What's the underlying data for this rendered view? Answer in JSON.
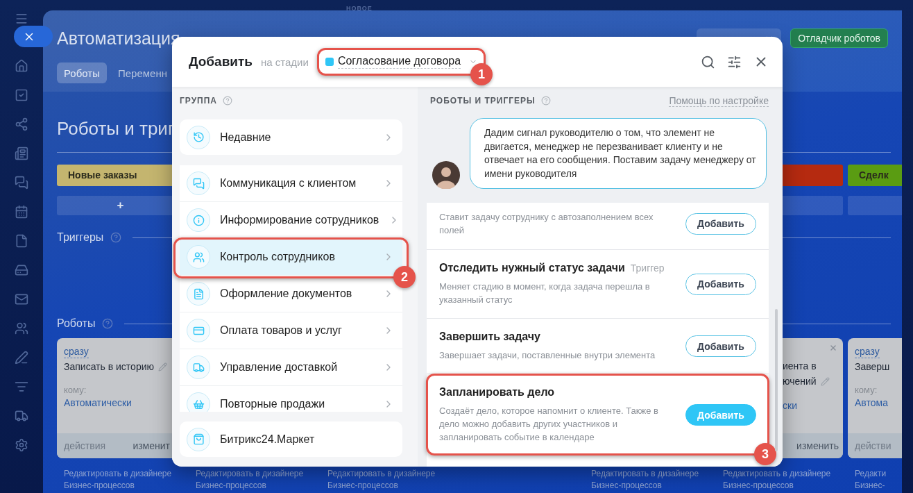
{
  "top_label": "НОВОЕ",
  "page": {
    "title": "Автоматизация",
    "debugger_button": "Отладчик роботов",
    "tabs": [
      {
        "label": "Роботы",
        "selected": true
      },
      {
        "label": "Переменн",
        "selected": false
      }
    ],
    "heading": "Роботы и триг",
    "triggers_label": "Триггеры",
    "robots_label": "Роботы",
    "columns": [
      {
        "stage": {
          "label": "Новые заказы",
          "color": "#c4b56f"
        },
        "add_bar": true,
        "add_label": "+",
        "card": {
          "delay": "сразу",
          "title_lines": [
            "Записать в историю"
          ],
          "editable": true,
          "to_label": "кому:",
          "to_value": "Автоматически",
          "actions": "действия",
          "edit": "изменит"
        },
        "link": [
          "Редактировать в дизайнере",
          "Бизнес-процессов"
        ]
      },
      {
        "link": [
          "Редактировать в дизайнере",
          "Бизнес-процессов"
        ]
      },
      {
        "link": [
          "Редактировать в дизайнере",
          "Бизнес-процессов"
        ]
      },
      {},
      {
        "link": [
          "Редактировать в дизайнере",
          "Бизнес-процессов"
        ]
      },
      {
        "stage": {
          "color": "#b52a10"
        },
        "add_bar": true,
        "card": {
          "partial": true,
          "closable": true,
          "title_lines": [
            "иента в",
            "ючений"
          ],
          "editable": true,
          "to_value": "ски",
          "edit": "изменить"
        },
        "link": [
          "Редактировать в дизайнере",
          "Бизнес-процессов"
        ]
      },
      {
        "stage": {
          "label": "Сделк",
          "color": "#5a9c12"
        },
        "add_bar": true,
        "card": {
          "delay": "сразу",
          "title_lines": [
            "Заверш"
          ],
          "to_label": "кому:",
          "to_value": "Автома",
          "actions": "действи"
        },
        "link": [
          "Редакти",
          "Бизнес-"
        ]
      }
    ]
  },
  "modal": {
    "title": "Добавить",
    "stage_prefix": "на стадии",
    "stage": {
      "label": "Согласование договора",
      "color": "#2fc6f6",
      "callout": "1"
    },
    "group_header": "ГРУППА",
    "recent": {
      "label": "Недавние"
    },
    "groups": [
      {
        "label": "Коммуникация с клиентом",
        "selected": false
      },
      {
        "label": "Информирование сотрудников",
        "selected": false
      },
      {
        "label": "Контроль сотрудников",
        "selected": true,
        "callout": "2"
      },
      {
        "label": "Оформление документов",
        "selected": false
      },
      {
        "label": "Оплата товаров и услуг",
        "selected": false
      },
      {
        "label": "Управление доставкой",
        "selected": false
      },
      {
        "label": "Повторные продажи",
        "selected": false
      }
    ],
    "market": {
      "label": "Битрикс24.Маркет"
    },
    "robots_header": "РОБОТЫ И ТРИГГЕРЫ",
    "help_link": "Помощь по настройке",
    "hint": "Дадим сигнал руководителю о том, что элемент не двигается, менеджер не перезванивает клиенту и не отвечает на его сообщения. Поставим задачу менеджеру от имени руководителя",
    "robots": [
      {
        "description": "Ставит задачу сотруднику с автозаполнением всех полей",
        "button": "Добавить",
        "primary": false
      },
      {
        "title": "Отследить нужный статус задачи",
        "tag": "Триггер",
        "description": "Меняет стадию в момент, когда задача перешла в указанный статус",
        "button": "Добавить",
        "primary": false
      },
      {
        "title": "Завершить задачу",
        "description": "Завершает задачи, поставленные внутри элемента",
        "button": "Добавить",
        "primary": false
      },
      {
        "title": "Запланировать дело",
        "description": "Создаёт дело, которое напомнит о клиенте. Также в дело можно добавить других участников и запланировать событие в календаре",
        "button": "Добавить",
        "primary": true,
        "callout": "3"
      }
    ]
  }
}
